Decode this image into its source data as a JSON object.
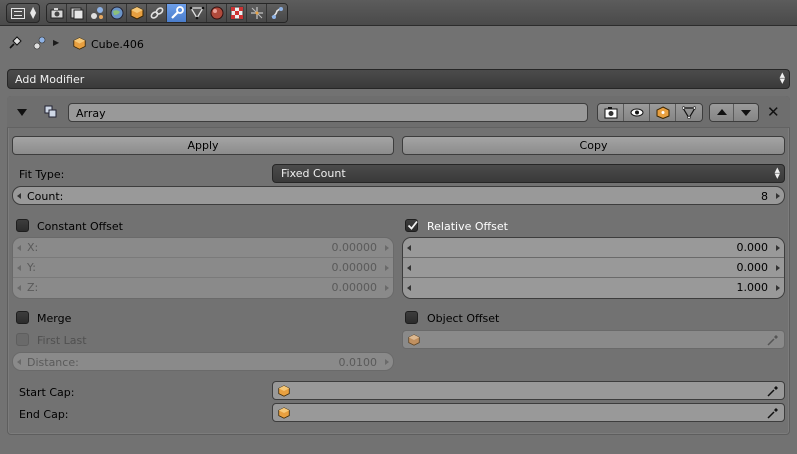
{
  "breadcrumb": {
    "object_name": "Cube.406"
  },
  "add_modifier": {
    "label": "Add Modifier"
  },
  "modifier": {
    "name": "Array",
    "apply_label": "Apply",
    "copy_label": "Copy",
    "fit_type_label": "Fit Type:",
    "fit_type_value": "Fixed Count",
    "count_label": "Count:",
    "count_value": "8",
    "constant_offset": {
      "label": "Constant Offset",
      "checked": false,
      "x_label": "X:",
      "x_value": "0.00000",
      "y_label": "Y:",
      "y_value": "0.00000",
      "z_label": "Z:",
      "z_value": "0.00000"
    },
    "relative_offset": {
      "label": "Relative Offset",
      "checked": true,
      "x_value": "0.000",
      "y_value": "0.000",
      "z_value": "1.000"
    },
    "merge": {
      "label": "Merge",
      "checked": false
    },
    "first_last": {
      "label": "First Last",
      "checked": false
    },
    "distance": {
      "label": "Distance:",
      "value": "0.0100"
    },
    "object_offset": {
      "label": "Object Offset",
      "checked": false
    },
    "start_cap_label": "Start Cap:",
    "end_cap_label": "End Cap:"
  },
  "colors": {
    "active_tab": "#5a8ad8",
    "panel_bg": "#727272",
    "dark_field": "#424242",
    "light_field": "#999999"
  },
  "icons": {
    "tabs": [
      "render-icon",
      "render-layers-icon",
      "scene-icon",
      "world-icon",
      "object-icon",
      "constraints-icon",
      "modifiers-wrench-icon",
      "data-mesh-icon",
      "material-icon",
      "texture-icon",
      "particles-icon",
      "physics-icon"
    ]
  }
}
